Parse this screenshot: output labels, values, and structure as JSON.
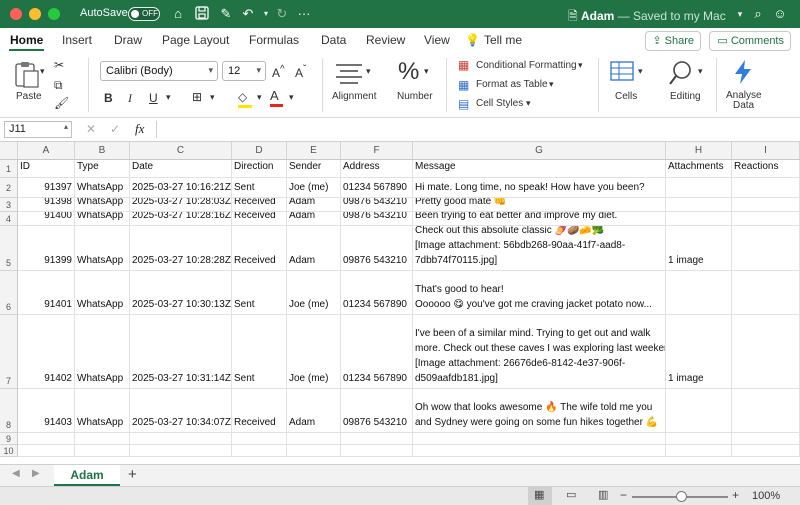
{
  "titlebar": {
    "autosave_label": "AutoSave",
    "autosave_state": "OFF",
    "doc_name": "Adam",
    "doc_status": " — Saved to my Mac"
  },
  "ribbon_tabs": [
    "Home",
    "Insert",
    "Draw",
    "Page Layout",
    "Formulas",
    "Data",
    "Review",
    "View"
  ],
  "tell_me": "Tell me",
  "share_label": "Share",
  "comments_label": "Comments",
  "ribbon": {
    "paste_label": "Paste",
    "font_name": "Calibri (Body)",
    "font_size": "12",
    "bold": "B",
    "italic": "I",
    "underline": "U",
    "alignment_label": "Alignment",
    "number_label": "Number",
    "conditional_formatting": "Conditional Formatting",
    "format_as_table": "Format as Table",
    "cell_styles": "Cell Styles",
    "cells_label": "Cells",
    "editing_label": "Editing",
    "analyse_label": "Analyse",
    "data_label": "Data",
    "accent_color": "#217346"
  },
  "formula_bar": {
    "name_box": "J11",
    "fx": "fx",
    "value": ""
  },
  "columns": [
    "A",
    "B",
    "C",
    "D",
    "E",
    "F",
    "G",
    "H",
    "I"
  ],
  "row_numbers": [
    "1",
    "2",
    "3",
    "4",
    "5",
    "6",
    "7",
    "8",
    "9",
    "10"
  ],
  "rows": [
    [
      "ID",
      "Type",
      "Date",
      "Direction",
      "Sender",
      "Address",
      "Message",
      "Attachments",
      "Reactions"
    ],
    [
      "91397",
      "WhatsApp",
      "2025-03-27 10:16:21Z",
      "Sent",
      "Joe (me)",
      "01234 567890",
      "Hi mate. Long time, no speak! How have you been?",
      "",
      ""
    ],
    [
      "91398",
      "WhatsApp",
      "2025-03-27 10:28:03Z",
      "Received",
      "Adam",
      "09876 543210",
      "Pretty good mate 👊",
      "",
      ""
    ],
    [
      "91400",
      "WhatsApp",
      "2025-03-27 10:28:16Z",
      "Received",
      "Adam",
      "09876 543210",
      "Been trying to eat better and improve my diet.",
      "",
      ""
    ],
    [
      "91399",
      "WhatsApp",
      "2025-03-27 10:28:28Z",
      "Received",
      "Adam",
      "09876 543210",
      "Check out this absolute classic 🍠🥔🧀🥦\n[Image attachment: 56bdb268-90aa-41f7-aad8-\n7dbb74f70115.jpg]",
      "1 image",
      ""
    ],
    [
      "91401",
      "WhatsApp",
      "2025-03-27 10:30:13Z",
      "Sent",
      "Joe (me)",
      "01234 567890",
      "That's good to hear!\nOooooo 😋 you've got me craving jacket potato now...",
      "",
      ""
    ],
    [
      "91402",
      "WhatsApp",
      "2025-03-27 10:31:14Z",
      "Sent",
      "Joe (me)",
      "01234 567890",
      "I've been of a similar mind. Trying to get out and walk\nmore. Check out these caves I was exploring last weekend\n[Image attachment: 26676de6-8142-4e37-906f-\nd509aafdb181.jpg]",
      "1 image",
      ""
    ],
    [
      "91403",
      "WhatsApp",
      "2025-03-27 10:34:07Z",
      "Received",
      "Adam",
      "09876 543210",
      "Oh wow that looks awesome 🔥 The wife told me you\nand Sydney were going on some fun hikes together 💪",
      "",
      ""
    ],
    [
      "",
      "",
      "",
      "",
      "",
      "",
      "",
      "",
      ""
    ],
    [
      "",
      "",
      "",
      "",
      "",
      "",
      "",
      "",
      ""
    ]
  ],
  "sheet_tab": "Adam",
  "add_sheet": "+",
  "zoom": "100%"
}
